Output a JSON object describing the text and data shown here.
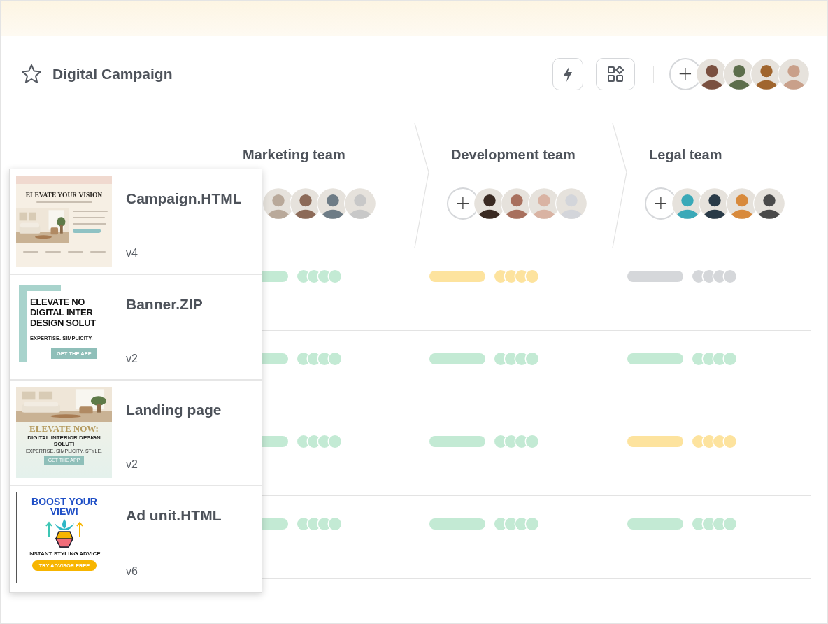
{
  "header": {
    "title": "Digital Campaign",
    "starred": false,
    "add_label": "+",
    "members": [
      {
        "color": "#7a5040"
      },
      {
        "color": "#5d6e4c"
      },
      {
        "color": "#a0652e"
      },
      {
        "color": "#c9a08a"
      }
    ]
  },
  "teams": [
    {
      "name": "Marketing team",
      "members": [
        {
          "color": "#b9a99a"
        },
        {
          "color": "#8c6a58"
        },
        {
          "color": "#6e7c86"
        },
        {
          "color": "#c8c8c8"
        }
      ]
    },
    {
      "name": "Development team",
      "add_label": "+",
      "members": [
        {
          "color": "#3a2a22"
        },
        {
          "color": "#a8705e"
        },
        {
          "color": "#d9b3a3"
        },
        {
          "color": "#d3d5da"
        }
      ]
    },
    {
      "name": "Legal team",
      "add_label": "+",
      "members": [
        {
          "color": "#3aa9b8"
        },
        {
          "color": "#2a3b48"
        },
        {
          "color": "#d88a3c"
        },
        {
          "color": "#4a4a4a"
        }
      ]
    }
  ],
  "rows": [
    {
      "cells": [
        {
          "color": "#c3ead4"
        },
        {
          "color": "#fde39e"
        },
        {
          "color": "#d5d7da"
        }
      ]
    },
    {
      "cells": [
        {
          "color": "#c3ead4"
        },
        {
          "color": "#c3ead4"
        },
        {
          "color": "#c3ead4"
        }
      ]
    },
    {
      "cells": [
        {
          "color": "#c3ead4"
        },
        {
          "color": "#c3ead4"
        },
        {
          "color": "#fde39e"
        }
      ]
    },
    {
      "cells": [
        {
          "color": "#c3ead4"
        },
        {
          "color": "#c3ead4"
        },
        {
          "color": "#c3ead4"
        }
      ]
    }
  ],
  "files": [
    {
      "name": "Campaign.HTML",
      "version": "v4",
      "thumbnail": {
        "kind": "website",
        "headline": "ELEVATE YOUR VISION"
      }
    },
    {
      "name": "Banner.ZIP",
      "version": "v2",
      "thumbnail": {
        "kind": "banner",
        "lines": [
          "ELEVATE NO",
          "DIGITAL INTER",
          "DESIGN SOLUT"
        ],
        "tagline": "EXPERTISE. SIMPLICITY.",
        "button": "GET THE APP"
      }
    },
    {
      "name": "Landing page",
      "version": "v2",
      "thumbnail": {
        "kind": "landing",
        "headline": "ELEVATE NOW:",
        "subheadline": "DIGITAL INTERIOR DESIGN SOLUTI",
        "tagline": "EXPERTISE. SIMPLICITY. STYLE.",
        "button": "GET THE APP"
      }
    },
    {
      "name": "Ad unit.HTML",
      "version": "v6",
      "thumbnail": {
        "kind": "ad",
        "headline": "BOOST YOUR VIEW!",
        "tagline": "INSTANT STYLING ADVICE",
        "button": "TRY ADVISOR FREE"
      }
    }
  ]
}
